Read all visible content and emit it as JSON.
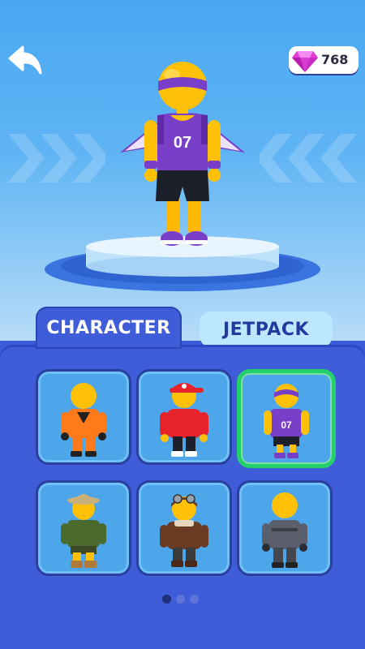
{
  "header": {
    "back_icon": "back-arrow-icon",
    "gems": {
      "icon": "gem-icon",
      "value": "768",
      "color": "#e23bd6"
    }
  },
  "hero": {
    "jersey_number": "07",
    "jersey_color": "#7a3fc9",
    "body_color": "#ffc107"
  },
  "tabs": [
    {
      "label": "CHARACTER",
      "active": true
    },
    {
      "label": "JETPACK",
      "active": false
    }
  ],
  "characters": [
    {
      "name": "orange-jumpsuit",
      "selected": false
    },
    {
      "name": "red-hoodie-cap",
      "selected": false
    },
    {
      "name": "basketball-07",
      "selected": true,
      "jersey_number": "07"
    },
    {
      "name": "safari-explorer",
      "selected": false
    },
    {
      "name": "aviator-pilot",
      "selected": false
    },
    {
      "name": "dark-suit",
      "selected": false
    }
  ],
  "pagination": {
    "current": 1,
    "total": 3
  },
  "colors": {
    "selected_border": "#24d06b",
    "panel": "#3f5dd8",
    "sky": "#49a8f2"
  }
}
